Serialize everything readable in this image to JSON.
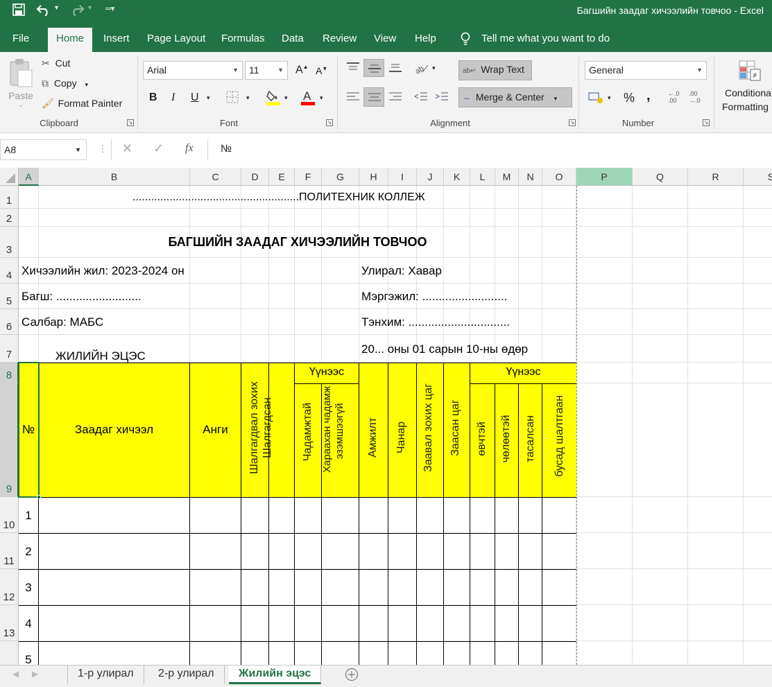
{
  "window": {
    "title": "Багшийн заадаг хичээлийн товчоо  -  Excel"
  },
  "ribbon_tabs": [
    "File",
    "Home",
    "Insert",
    "Page Layout",
    "Formulas",
    "Data",
    "Review",
    "View",
    "Help"
  ],
  "tell_me": "Tell me what you want to do",
  "clipboard": {
    "paste": "Paste",
    "cut": "Cut",
    "copy": "Copy",
    "format_painter": "Format Painter",
    "label": "Clipboard"
  },
  "font": {
    "name": "Arial",
    "size": "11",
    "label": "Font",
    "bold": "B",
    "italic": "I",
    "underline": "U"
  },
  "alignment": {
    "wrap_text": "Wrap Text",
    "merge_center": "Merge & Center",
    "label": "Alignment"
  },
  "number": {
    "format": "General",
    "label": "Number",
    "percent": "%",
    "comma": ","
  },
  "styles": {
    "conditional_formatting": [
      "Conditional",
      "Formatting"
    ]
  },
  "formula_bar": {
    "name_box": "A8",
    "fx": "fx",
    "content": "№"
  },
  "columns": [
    "A",
    "B",
    "C",
    "D",
    "E",
    "F",
    "G",
    "H",
    "I",
    "J",
    "K",
    "L",
    "M",
    "N",
    "O",
    "P",
    "Q",
    "R",
    "S"
  ],
  "rows": [
    "1",
    "2",
    "3",
    "4",
    "5",
    "6",
    "7",
    "8",
    "9",
    "10",
    "11",
    "12",
    "13"
  ],
  "sheet": {
    "r1": "......................................................ПОЛИТЕХНИК КОЛЛЕЖ",
    "r3": "БАГШИЙН ЗААДАГ ХИЧЭЭЛИЙН ТОВЧОО",
    "r4_left": "Хичээлийн жил: 2023-2024 он",
    "r4_right": "Улирал: Хавар",
    "r5_left": "Багш: ..........................",
    "r5_right": "Мэргэжил: ..........................",
    "r6_left": "Салбар: МАБС",
    "r6_right": "Тэнхим: ...............................",
    "r7_left": "ЖИЛИЙН ЭЦЭС",
    "r7_right": "20... оны 01 сарын 10-ны өдөр",
    "headers": {
      "no": "№",
      "subject": "Заадаг хичээл",
      "group": "Анги",
      "to_pass": "Шалгагдвал зохих",
      "passed": "Шалгагдсан",
      "eval1": "Үүнээс",
      "capable": "Чадамжтай",
      "not_capable": [
        "Хараахан чадамж",
        "эзэмшээгүй"
      ],
      "success": "Амжилт",
      "quality": "Чанар",
      "required_hours": "Заавал зохих цаг",
      "taught_hours": "Заасан цаг",
      "eval2": "Үүнээс",
      "sick": "өвчтэй",
      "leave": "чөлөөтэй",
      "absent": "тасалсан",
      "other": "бусад шалтгаан"
    },
    "row_numbers": [
      "1",
      "2",
      "3",
      "4",
      "5"
    ]
  },
  "sheet_tabs": [
    "1-р улирал",
    "2-р улирал",
    "Жилийн эцэс"
  ],
  "colors": {
    "excel_green": "#217346",
    "highlight_yellow": "#ffff00"
  }
}
